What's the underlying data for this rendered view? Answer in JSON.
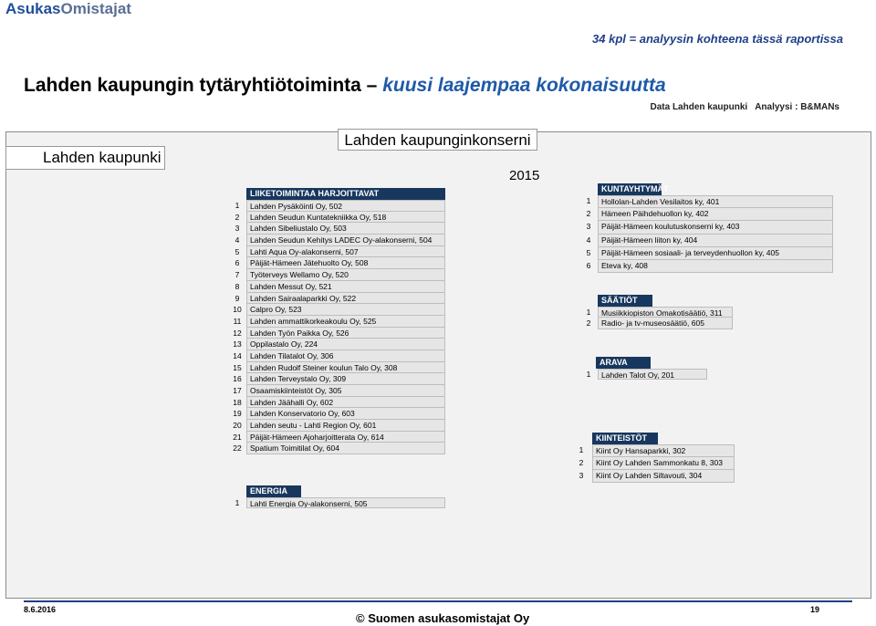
{
  "header": {
    "brand_part1": "Asukas",
    "brand_part2": "Omistajat",
    "count_note": "34 kpl  = analyysin kohteena tässä raportissa",
    "title_main": "Lahden kaupungin tytäryhtiötoiminta –",
    "title_emphasis": "kuusi laajempaa kokonaisuutta",
    "data_source": "Data Lahden kaupunki",
    "analysis_source": "Analyysi : B&MANs"
  },
  "diagram": {
    "city_label": "Lahden kaupunki",
    "konserni_title": "Lahden kaupunginkonserni",
    "year": "2015",
    "groups": {
      "liiketoiminta": {
        "title": "LIIKETOIMINTAA HARJOITTAVAT",
        "items": [
          {
            "num": "1",
            "name": "Lahden Pysäköinti Oy, 502"
          },
          {
            "num": "2",
            "name": "Lahden Seudun Kuntatekniikka Oy, 518"
          },
          {
            "num": "3",
            "name": "Lahden Sibeliustalo Oy, 503"
          },
          {
            "num": "4",
            "name": "Lahden Seudun Kehitys LADEC Oy-alakonserni, 504"
          },
          {
            "num": "5",
            "name": "Lahti Aqua Oy-alakonserni, 507"
          },
          {
            "num": "6",
            "name": "Päijät-Hämeen Jätehuolto Oy, 508"
          },
          {
            "num": "7",
            "name": "Työterveys Wellamo Oy, 520"
          },
          {
            "num": "8",
            "name": "Lahden Messut Oy, 521"
          },
          {
            "num": "9",
            "name": "Lahden Sairaalaparkki Oy, 522"
          },
          {
            "num": "10",
            "name": "Calpro Oy, 523"
          },
          {
            "num": "11",
            "name": "Lahden ammattikorkeakoulu Oy, 525"
          },
          {
            "num": "12",
            "name": "Lahden Työn Paikka Oy, 526"
          },
          {
            "num": "13",
            "name": "Oppilastalo Oy, 224"
          },
          {
            "num": "14",
            "name": "Lahden Tilatalot Oy, 306"
          },
          {
            "num": "15",
            "name": "Lahden Rudolf Steiner koulun Talo Oy, 308"
          },
          {
            "num": "16",
            "name": "Lahden Terveystalo Oy, 309"
          },
          {
            "num": "17",
            "name": "Osaamiskiinteistöt Oy, 305"
          },
          {
            "num": "18",
            "name": "Lahden Jäähalli Oy, 602"
          },
          {
            "num": "19",
            "name": "Lahden Konservatorio Oy, 603"
          },
          {
            "num": "20",
            "name": "Lahden seutu - Lahti Region Oy, 601"
          },
          {
            "num": "21",
            "name": "Päijät-Hämeen Ajoharjoitterata Oy, 614"
          },
          {
            "num": "22",
            "name": "Spatium Toimitilat Oy, 604"
          }
        ]
      },
      "energia": {
        "title": "ENERGIA",
        "items": [
          {
            "num": "1",
            "name": "Lahti Energia Oy-alakonserni, 505"
          }
        ]
      },
      "kuntayhtymat": {
        "title": "KUNTAYHTYMÄT",
        "items": [
          {
            "num": "1",
            "name": "Hollolan-Lahden Vesilaitos ky, 401"
          },
          {
            "num": "2",
            "name": "Hämeen Päihdehuollon ky, 402"
          },
          {
            "num": "3",
            "name": "Päijät-Hämeen koulutuskonserni ky, 403"
          },
          {
            "num": "4",
            "name": "Päijät-Hämeen liiton ky, 404"
          },
          {
            "num": "5",
            "name": "Päijät-Hämeen sosiaali- ja terveydenhuollon ky, 405"
          },
          {
            "num": "6",
            "name": "Eteva ky, 408"
          }
        ]
      },
      "saatiot": {
        "title": "SÄÄTIÖT",
        "items": [
          {
            "num": "1",
            "name": "Musiikkiopiston Omakotisäätiö, 311"
          },
          {
            "num": "2",
            "name": "Radio- ja tv-museosäätiö, 605"
          }
        ]
      },
      "arava": {
        "title": "ARAVA",
        "items": [
          {
            "num": "1",
            "name": "Lahden Talot Oy, 201"
          }
        ]
      },
      "kiinteistot": {
        "title": "KIINTEISTÖT",
        "items": [
          {
            "num": "1",
            "name": "Kiint Oy Hansaparkki, 302"
          },
          {
            "num": "2",
            "name": "Kiint Oy Lahden Sammonkatu 8, 303"
          },
          {
            "num": "3",
            "name": "Kiint Oy Lahden Siltavouti, 304"
          }
        ]
      }
    }
  },
  "footer": {
    "date": "8.6.2016",
    "copyright": "© Suomen asukasomistajat Oy",
    "page": "19"
  }
}
